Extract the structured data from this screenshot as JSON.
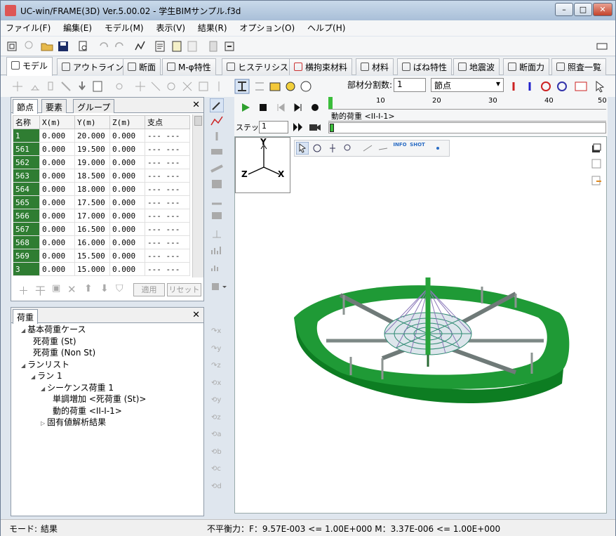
{
  "window": {
    "title": "UC-win/FRAME(3D) Ver.5.00.02 - 学生BIMサンプル.f3d"
  },
  "menu": [
    "ファイル(F)",
    "編集(E)",
    "モデル(M)",
    "表示(V)",
    "結果(R)",
    "オプション(O)",
    "ヘルプ(H)"
  ],
  "tabs": [
    "モデル",
    "アウトライン",
    "断面",
    "M-φ特性",
    "ヒステリシス",
    "横拘束材料",
    "材料",
    "ばね特性",
    "地震波",
    "断面力",
    "照査一覧"
  ],
  "toolbar2": {
    "division_label": "部材分割数:",
    "division_value": "1",
    "node_select": "節点"
  },
  "left_top_tabs": [
    "節点",
    "要素",
    "グループ"
  ],
  "node_table": {
    "headers": [
      "名称",
      "X(m)",
      "Y(m)",
      "Z(m)",
      "支点"
    ],
    "rows": [
      [
        "1",
        "0.000",
        "20.000",
        "0.000",
        "--- ---"
      ],
      [
        "561",
        "0.000",
        "19.500",
        "0.000",
        "--- ---"
      ],
      [
        "562",
        "0.000",
        "19.000",
        "0.000",
        "--- ---"
      ],
      [
        "563",
        "0.000",
        "18.500",
        "0.000",
        "--- ---"
      ],
      [
        "564",
        "0.000",
        "18.000",
        "0.000",
        "--- ---"
      ],
      [
        "565",
        "0.000",
        "17.500",
        "0.000",
        "--- ---"
      ],
      [
        "566",
        "0.000",
        "17.000",
        "0.000",
        "--- ---"
      ],
      [
        "567",
        "0.000",
        "16.500",
        "0.000",
        "--- ---"
      ],
      [
        "568",
        "0.000",
        "16.000",
        "0.000",
        "--- ---"
      ],
      [
        "569",
        "0.000",
        "15.500",
        "0.000",
        "--- ---"
      ],
      [
        "3",
        "0.000",
        "15.000",
        "0.000",
        "--- ---"
      ]
    ]
  },
  "table_buttons": {
    "apply": "適用",
    "reset": "リセット"
  },
  "load_panel": {
    "tab": "荷重",
    "tree": [
      {
        "level": 0,
        "text": "基本荷重ケース"
      },
      {
        "level": 1,
        "text": "死荷重 (St)"
      },
      {
        "level": 1,
        "text": "死荷重 (Non St)"
      },
      {
        "level": 0,
        "text": "ランリスト"
      },
      {
        "level": 1,
        "text": "ラン 1"
      },
      {
        "level": 2,
        "text": "シーケンス荷重 1"
      },
      {
        "level": 3,
        "text": "単調増加 <死荷重 (St)>"
      },
      {
        "level": 3,
        "text": "動的荷重 <II-I-1>"
      },
      {
        "level": 2,
        "text": "固有値解析結果"
      }
    ]
  },
  "playback": {
    "ruler_ticks": [
      "10",
      "20",
      "30",
      "40",
      "50"
    ],
    "track_label": "動的荷重 <II-I-1>",
    "step_label": "ステップ",
    "step_value": "1"
  },
  "axes": {
    "y": "Y",
    "z": "Z",
    "x": "X"
  },
  "view_toolbar": {
    "info": "INFO",
    "shot": "SHOT"
  },
  "status": {
    "mode_label": "モード:",
    "mode_value": "結果",
    "balance": "不平衡力：F：9.57E-003 <= 1.00E+000 M：3.37E-006 <= 1.00E+000"
  },
  "colors": {
    "ring": "#1f9a36",
    "node_cell": "#2f7d32",
    "accent": "#2a6cc4"
  }
}
